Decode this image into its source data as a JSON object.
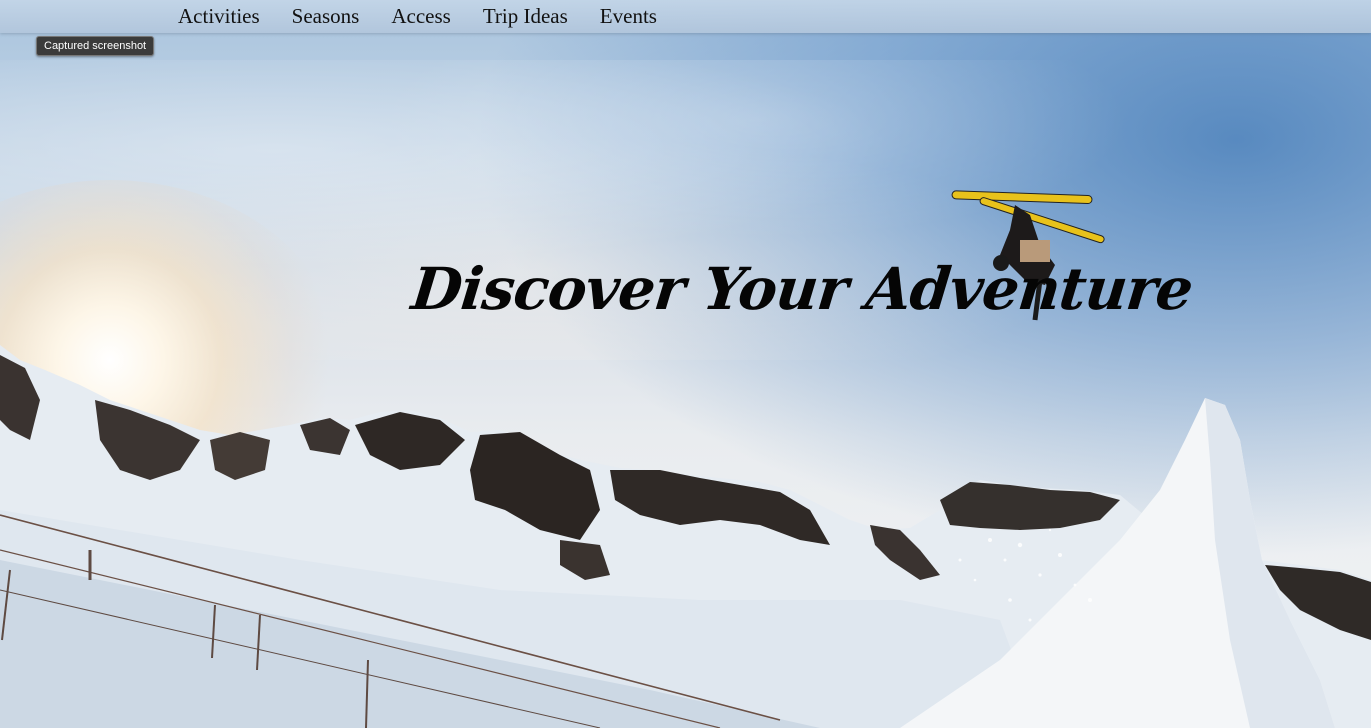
{
  "nav": {
    "items": [
      {
        "label": "Activities"
      },
      {
        "label": "Seasons"
      },
      {
        "label": "Access"
      },
      {
        "label": "Trip Ideas"
      },
      {
        "label": "Events"
      }
    ]
  },
  "tooltip": {
    "text": "Captured screenshot"
  },
  "hero": {
    "title": "Discover Your Adventure"
  },
  "colors": {
    "nav_bg": "#bccfe3",
    "title": "#050505",
    "snow": "#f2f5f8",
    "rock": "#2b2623"
  }
}
